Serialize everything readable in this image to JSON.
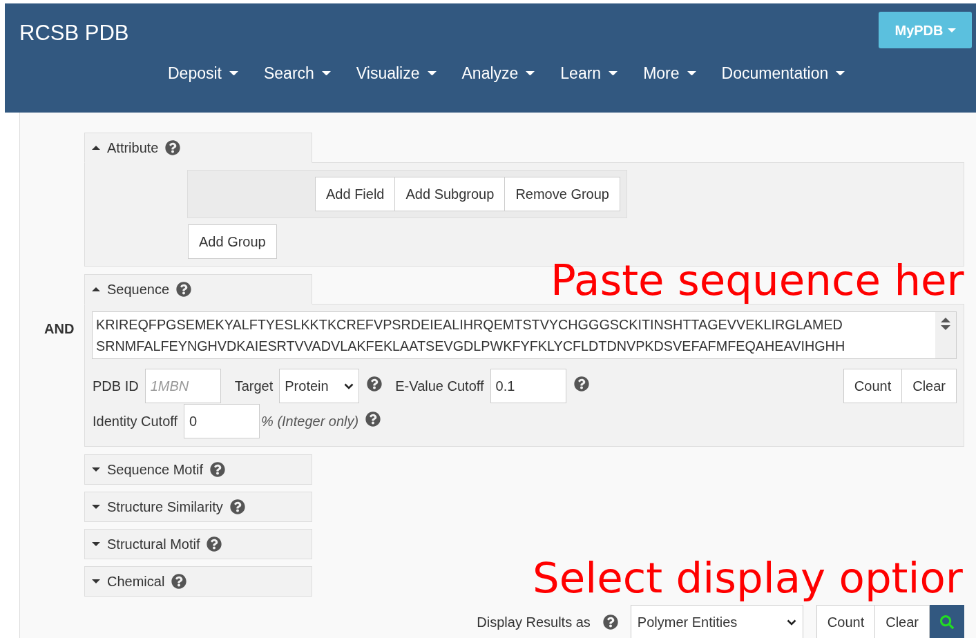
{
  "brand": "RCSB PDB",
  "user_menu": {
    "label": "MyPDB"
  },
  "nav": [
    {
      "label": "Deposit"
    },
    {
      "label": "Search"
    },
    {
      "label": "Visualize"
    },
    {
      "label": "Analyze"
    },
    {
      "label": "Learn"
    },
    {
      "label": "More"
    },
    {
      "label": "Documentation"
    }
  ],
  "groups": [
    {
      "kind": "attribute",
      "title": "Attribute",
      "expanded": true,
      "buttons": [
        "Add Field",
        "Add Subgroup",
        "Remove Group"
      ],
      "add_group": "Add Group"
    },
    {
      "kind": "sequence",
      "title": "Sequence",
      "expanded": true,
      "operator": "AND",
      "sequence": "KRIREQFPGSEMEKYALFTYESLKKTKCREFVPSRDEIEALIHRQEMTSTVYCHGGGSCKITINSHTTAGEVVEKLIRGLAMED\nSRNMFALFEYNGHVDKAIESRTVVADVLAKFEKLAATSEVGDLPWKFYFKLYCFLDTDNVPKDSVEFAFMFEQAHEAVIHGHH",
      "pdb_id": {
        "label": "PDB ID",
        "placeholder": "1MBN"
      },
      "target": {
        "label": "Target",
        "value": "Protein"
      },
      "evalue": {
        "label": "E-Value Cutoff",
        "value": "0.1"
      },
      "buttons": [
        "Count",
        "Clear"
      ],
      "identity": {
        "label": "Identity Cutoff",
        "value": "0",
        "note": "% (Integer only)"
      }
    },
    {
      "title": "Sequence Motif",
      "expanded": false
    },
    {
      "title": "Structure Similarity",
      "expanded": false
    },
    {
      "title": "Structural Motif",
      "expanded": false
    },
    {
      "title": "Chemical",
      "expanded": false
    }
  ],
  "display": {
    "label": "Display Results as",
    "value": "Polymer Entities",
    "buttons": [
      "Count",
      "Clear"
    ]
  },
  "annotations": [
    "Paste sequence her",
    "Select display optior"
  ]
}
